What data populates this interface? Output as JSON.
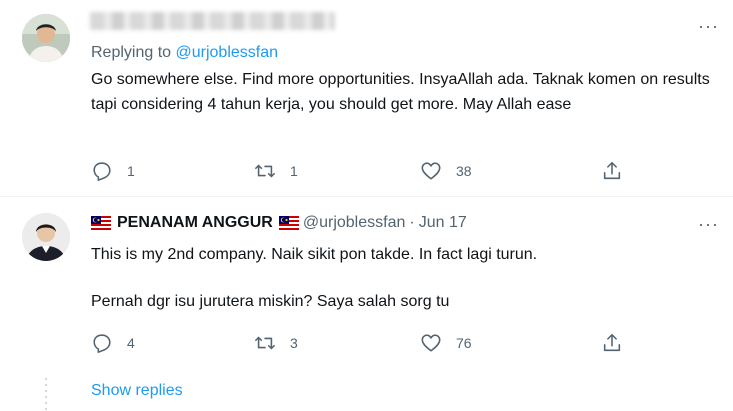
{
  "tweet1": {
    "replying_prefix": "Replying to ",
    "replying_handle": "@urjoblessfan",
    "text": "Go somewhere else. Find more opportunities. InsyaAllah ada. Taknak komen on results tapi considering 4 tahun kerja, you should get more. May Allah ease",
    "reply_count": "1",
    "retweet_count": "1",
    "like_count": "38",
    "more_label": "···"
  },
  "tweet2": {
    "display_name": "PENANAM ANGGUR",
    "handle": "@urjoblessfan",
    "separator": "·",
    "date": "Jun 17",
    "line1": "This is my 2nd company. Naik sikit pon takde. In fact lagi turun.",
    "line2": "Pernah dgr isu jurutera miskin? Saya salah sorg tu",
    "reply_count": "4",
    "retweet_count": "3",
    "like_count": "76",
    "more_label": "···"
  },
  "show_replies": "Show replies",
  "icons": {
    "reply": "reply-icon",
    "retweet": "retweet-icon",
    "like": "heart-icon",
    "share": "share-icon",
    "flag": "malaysia-flag-icon"
  },
  "colors": {
    "accent": "#1d9bf0",
    "secondary_text": "#536471",
    "divider": "#eff3f4"
  }
}
